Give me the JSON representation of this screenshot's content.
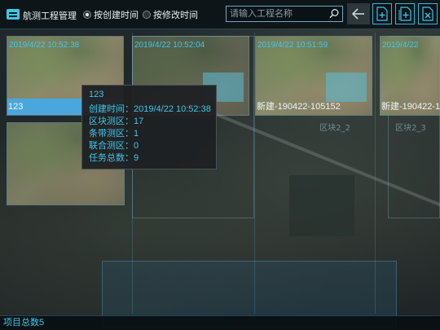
{
  "app": {
    "title": "航测工程管理"
  },
  "sort": {
    "by_created_label": "按创建时间",
    "by_modified_label": "按修改时间",
    "selected": "by_created"
  },
  "search": {
    "placeholder": "请输入工程名称",
    "value": ""
  },
  "toolbar": {
    "icons": [
      "back-arrow-icon",
      "new-project-icon",
      "import-project-icon",
      "delete-project-icon"
    ]
  },
  "cards": [
    {
      "date": "2019/4/22 10:52:38",
      "label": "123",
      "zone": ""
    },
    {
      "date": "2019/4/22 10:52:04",
      "label": "",
      "zone": ""
    },
    {
      "date": "2019/4/22 10:51:59",
      "label": "新建-190422-105152",
      "zone": "区块2_2"
    },
    {
      "date": "2019/4/22",
      "label": "新建-190422-1",
      "zone": "区块2_3"
    }
  ],
  "tooltip": {
    "title": "123",
    "rows": [
      "创建时间：2019/4/22 10:52:38",
      "区块测区：17",
      "条带测区：1",
      "联合测区：0",
      "任务总数：9"
    ]
  },
  "status": {
    "total": "项目总数5"
  },
  "colors": {
    "accent": "#3fc7ea",
    "selected_label_bg": "#4aa7dd"
  }
}
